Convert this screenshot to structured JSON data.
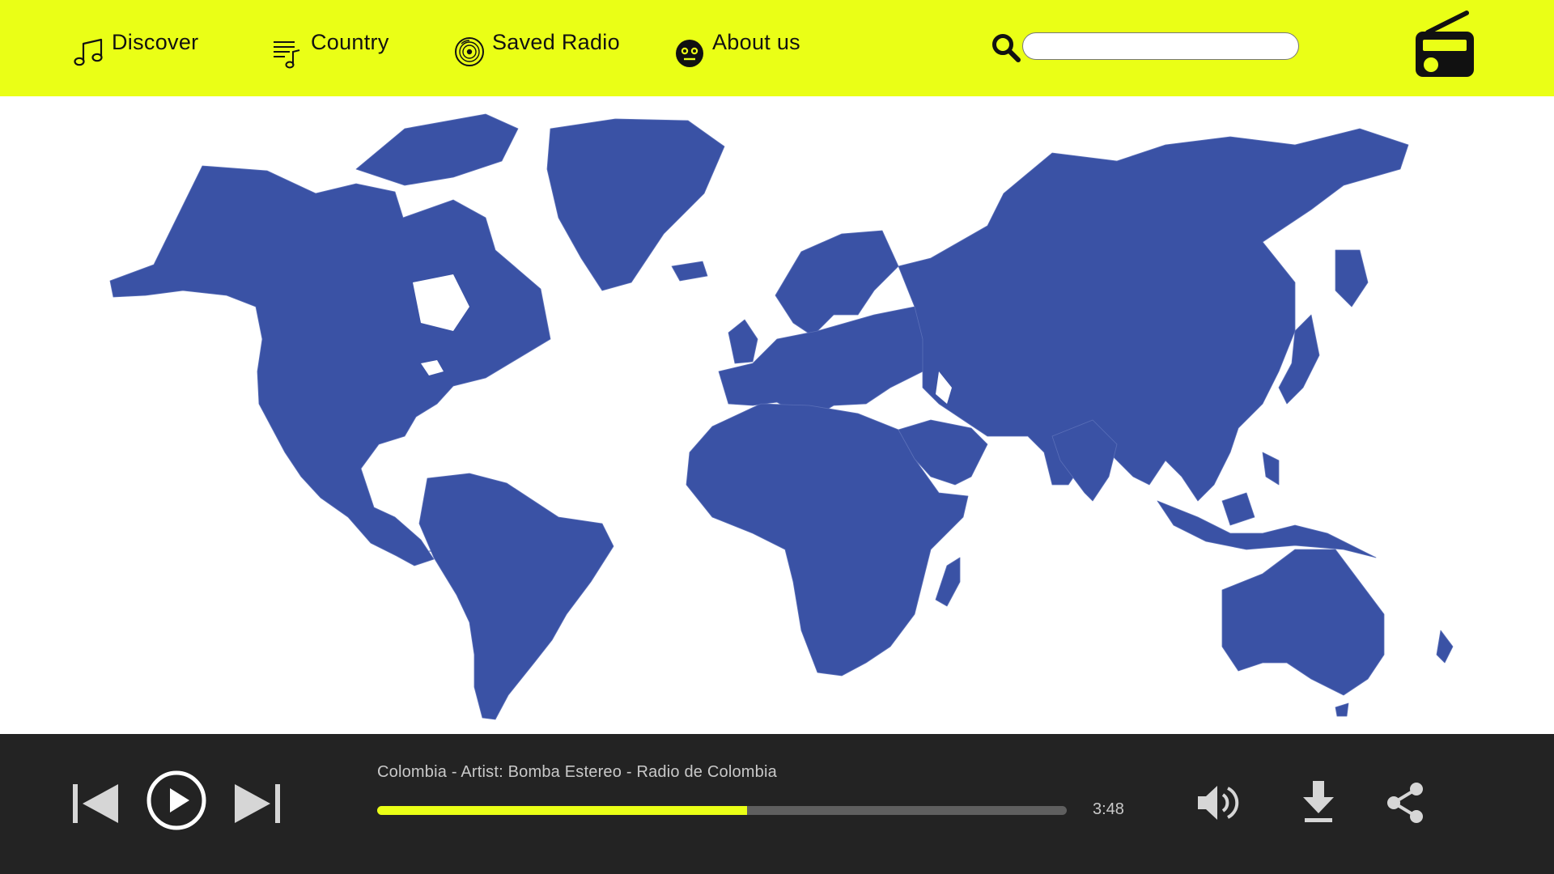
{
  "nav": {
    "items": [
      {
        "label": "Discover",
        "icon": "music-note-icon"
      },
      {
        "label": "Country",
        "icon": "playlist-icon"
      },
      {
        "label": "Saved Radio",
        "icon": "vinyl-record-icon"
      },
      {
        "label": "About us",
        "icon": "face-icon"
      }
    ],
    "search": {
      "placeholder": "",
      "value": "",
      "icon": "search-icon"
    },
    "logo_icon": "radio-icon"
  },
  "map": {
    "land_color": "#3a52a5",
    "background": "#ffffff"
  },
  "player": {
    "now_playing": "Colombia - Artist: Bomba Estereo - Radio de Colombia",
    "duration": "3:48",
    "progress": 0.536,
    "controls": [
      "previous-icon",
      "play-icon",
      "next-icon",
      "volume-icon",
      "download-icon",
      "share-icon"
    ]
  },
  "colors": {
    "accent": "#eaff16",
    "player_bg": "#232323",
    "track_bg": "#5f5f5f",
    "control": "#d6d6d6"
  }
}
